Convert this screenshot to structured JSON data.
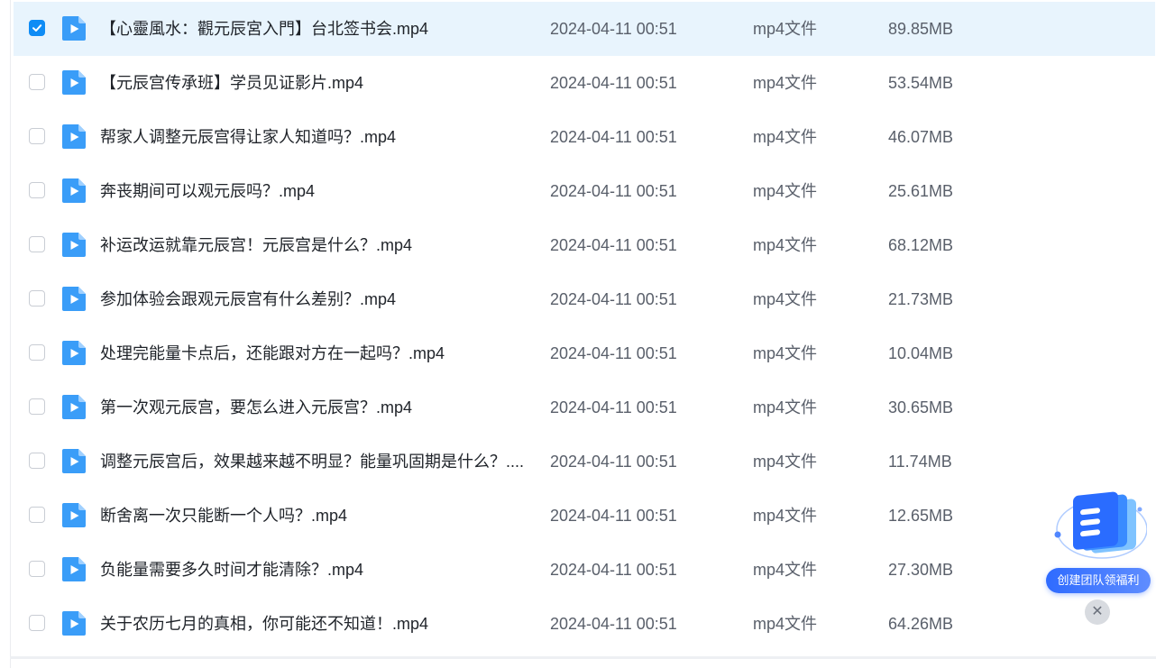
{
  "files": [
    {
      "name": "【心靈風水：觀元辰宮入門】台北签书会.mp4",
      "date": "2024-04-11 00:51",
      "type": "mp4文件",
      "size": "89.85MB",
      "checked": true
    },
    {
      "name": "【元辰宫传承班】学员见证影片.mp4",
      "date": "2024-04-11 00:51",
      "type": "mp4文件",
      "size": "53.54MB",
      "checked": false
    },
    {
      "name": "帮家人调整元辰宫得让家人知道吗？.mp4",
      "date": "2024-04-11 00:51",
      "type": "mp4文件",
      "size": "46.07MB",
      "checked": false
    },
    {
      "name": "奔丧期间可以观元辰吗？.mp4",
      "date": "2024-04-11 00:51",
      "type": "mp4文件",
      "size": "25.61MB",
      "checked": false
    },
    {
      "name": "补运改运就靠元辰宫！元辰宫是什么？.mp4",
      "date": "2024-04-11 00:51",
      "type": "mp4文件",
      "size": "68.12MB",
      "checked": false
    },
    {
      "name": "参加体验会跟观元辰宫有什么差别？.mp4",
      "date": "2024-04-11 00:51",
      "type": "mp4文件",
      "size": "21.73MB",
      "checked": false
    },
    {
      "name": "处理完能量卡点后，还能跟对方在一起吗？.mp4",
      "date": "2024-04-11 00:51",
      "type": "mp4文件",
      "size": "10.04MB",
      "checked": false
    },
    {
      "name": "第一次观元辰宫，要怎么进入元辰宫？.mp4",
      "date": "2024-04-11 00:51",
      "type": "mp4文件",
      "size": "30.65MB",
      "checked": false
    },
    {
      "name": "调整元辰宫后，效果越来越不明显？能量巩固期是什么？....",
      "date": "2024-04-11 00:51",
      "type": "mp4文件",
      "size": "11.74MB",
      "checked": false
    },
    {
      "name": "断舍离一次只能断一个人吗？.mp4",
      "date": "2024-04-11 00:51",
      "type": "mp4文件",
      "size": "12.65MB",
      "checked": false
    },
    {
      "name": "负能量需要多久时间才能清除？.mp4",
      "date": "2024-04-11 00:51",
      "type": "mp4文件",
      "size": "27.30MB",
      "checked": false
    },
    {
      "name": "关于农历七月的真相，你可能还不知道！.mp4",
      "date": "2024-04-11 00:51",
      "type": "mp4文件",
      "size": "64.26MB",
      "checked": false
    }
  ],
  "promo": {
    "label": "创建团队领福利",
    "close_glyph": "✕"
  },
  "colors": {
    "accent": "#0f8cf5",
    "selected_row": "#e8f4fd",
    "file_icon": "#3a9df8",
    "text_primary": "#1f2329",
    "text_secondary": "#595f6a"
  },
  "icons": {
    "file": "video-file-icon",
    "check": "checkmark-icon",
    "close": "close-icon",
    "promo": "team-document-icon"
  }
}
